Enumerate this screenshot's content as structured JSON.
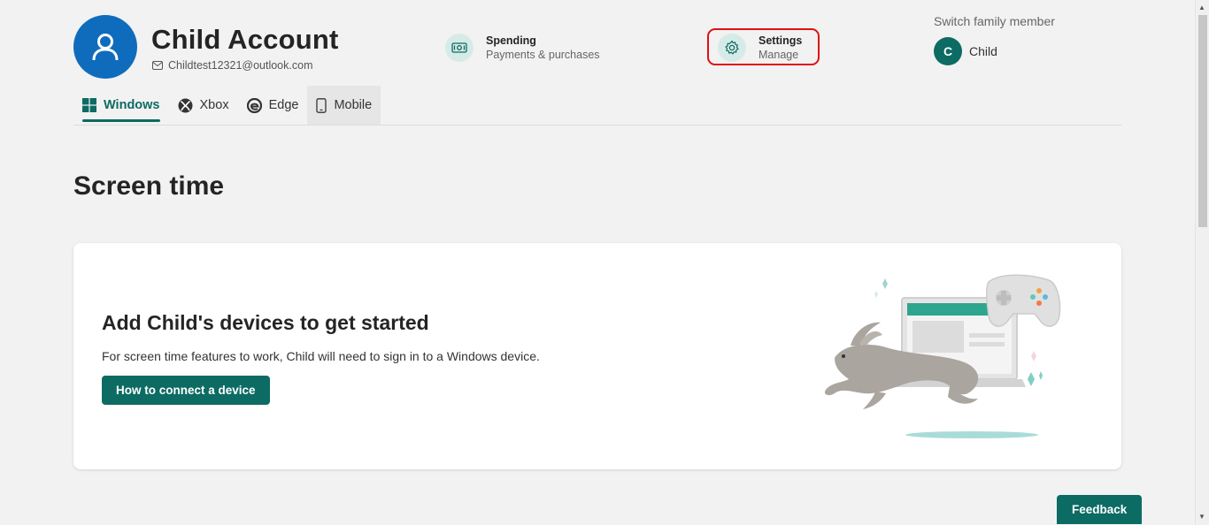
{
  "header": {
    "account_name": "Child Account",
    "email": "Childtest12321@outlook.com",
    "spending": {
      "title": "Spending",
      "subtitle": "Payments & purchases"
    },
    "settings": {
      "title": "Settings",
      "subtitle": "Manage"
    },
    "switch_label": "Switch family member",
    "member": {
      "initial": "C",
      "name": "Child"
    }
  },
  "tabs": [
    {
      "label": "Windows",
      "icon": "windows-icon",
      "active": true
    },
    {
      "label": "Xbox",
      "icon": "xbox-icon"
    },
    {
      "label": "Edge",
      "icon": "edge-icon"
    },
    {
      "label": "Mobile",
      "icon": "mobile-icon"
    }
  ],
  "main": {
    "title": "Screen time",
    "card": {
      "title": "Add Child's devices to get started",
      "description": "For screen time features to work, Child will need to sign in to a Windows device.",
      "button": "How to connect a device"
    }
  },
  "feedback_label": "Feedback",
  "colors": {
    "accent": "#0c6b63",
    "avatar_blue": "#0f6cbd",
    "highlight": "#e01010"
  }
}
